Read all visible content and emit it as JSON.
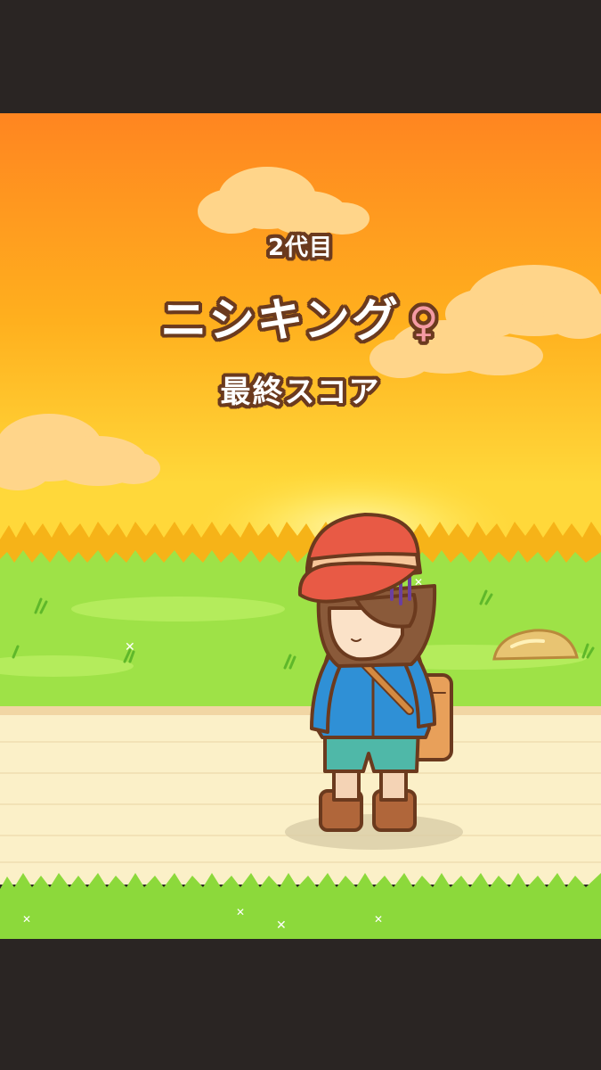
{
  "header": {
    "generation": "2代目",
    "character_name": "ニシキング",
    "gender_symbol": "♀",
    "score_label": "最終スコア"
  },
  "colors": {
    "sky_top": "#ff8a1c",
    "sky_bottom": "#ffd23a",
    "grass": "#9ae043",
    "path": "#fbf0c8",
    "outline": "#6b3a1e",
    "gender_female": "#f39aa3",
    "letterbox": "#2a2523"
  },
  "icons": {
    "gender": "female-symbol-icon"
  }
}
